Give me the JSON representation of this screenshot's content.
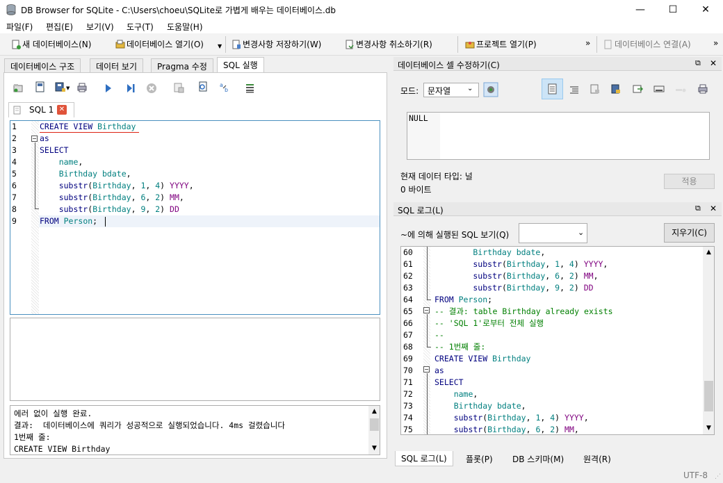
{
  "window": {
    "title": "DB Browser for SQLite - C:\\Users\\choeu\\SQLite로 가볍게 배우는 데이터베이스.db",
    "minimize": "—",
    "maximize": "☐",
    "close": "✕"
  },
  "menu": [
    "파일(F)",
    "편집(E)",
    "보기(V)",
    "도구(T)",
    "도움말(H)"
  ],
  "toolbar": {
    "new_db": "새 데이터베이스(N)",
    "open_db": "데이터베이스 열기(O)",
    "write_changes": "변경사항 저장하기(W)",
    "revert_changes": "변경사항 취소하기(R)",
    "open_project": "프로젝트 열기(P)",
    "more": "»",
    "attach_db": "데이터베이스 연결(A)",
    "more2": "»"
  },
  "main_tabs": [
    "데이터베이스 구조",
    "데이터 보기",
    "Pragma 수정",
    "SQL 실행"
  ],
  "sql_tab_label": "SQL 1",
  "editor": {
    "lines": [
      {
        "n": "1",
        "parts": [
          [
            "kw",
            "CREATE VIEW "
          ],
          [
            "id",
            "Birthday"
          ]
        ]
      },
      {
        "n": "2",
        "parts": [
          [
            "kw",
            "as"
          ]
        ]
      },
      {
        "n": "3",
        "parts": [
          [
            "kw",
            "SELECT"
          ]
        ]
      },
      {
        "n": "4",
        "parts": [
          [
            "id",
            "    name"
          ],
          [
            "tx",
            ","
          ]
        ]
      },
      {
        "n": "5",
        "parts": [
          [
            "id",
            "    Birthday bdate"
          ],
          [
            "tx",
            ","
          ]
        ]
      },
      {
        "n": "6",
        "parts": [
          [
            "kw",
            "    substr"
          ],
          [
            "tx",
            "("
          ],
          [
            "id",
            "Birthday"
          ],
          [
            "tx",
            ", "
          ],
          [
            "num",
            "1"
          ],
          [
            "tx",
            ", "
          ],
          [
            "num",
            "4"
          ],
          [
            "tx",
            ") "
          ],
          [
            "al",
            "YYYY"
          ],
          [
            "tx",
            ","
          ]
        ]
      },
      {
        "n": "7",
        "parts": [
          [
            "kw",
            "    substr"
          ],
          [
            "tx",
            "("
          ],
          [
            "id",
            "Birthday"
          ],
          [
            "tx",
            ", "
          ],
          [
            "num",
            "6"
          ],
          [
            "tx",
            ", "
          ],
          [
            "num",
            "2"
          ],
          [
            "tx",
            ") "
          ],
          [
            "al",
            "MM"
          ],
          [
            "tx",
            ","
          ]
        ]
      },
      {
        "n": "8",
        "parts": [
          [
            "kw",
            "    substr"
          ],
          [
            "tx",
            "("
          ],
          [
            "id",
            "Birthday"
          ],
          [
            "tx",
            ", "
          ],
          [
            "num",
            "9"
          ],
          [
            "tx",
            ", "
          ],
          [
            "num",
            "2"
          ],
          [
            "tx",
            ") "
          ],
          [
            "al",
            "DD"
          ]
        ]
      },
      {
        "n": "9",
        "parts": [
          [
            "kw",
            "FROM "
          ],
          [
            "id",
            "Person"
          ],
          [
            "tx",
            ";"
          ]
        ]
      }
    ]
  },
  "message": {
    "lines": [
      "에러 없이 실행 완료.",
      "결과:  데이터베이스에 쿼리가 성공적으로 실행되었습니다. 4ms 걸렸습니다",
      "1번째 줄:",
      "CREATE VIEW Birthday"
    ]
  },
  "cell_editor": {
    "title": "데이터베이스 셀 수정하기(C)",
    "mode_label": "모드:",
    "mode_value": "문자열",
    "value": "NULL",
    "type_label": "현재 데이터 타입: 널",
    "size_label": "0 바이트",
    "apply": "적용"
  },
  "sql_log": {
    "title": "SQL 로그(L)",
    "filter_label": "~에 의해 실행된 SQL 보기(Q)",
    "clear": "지우기(C)",
    "lines": [
      {
        "n": "60",
        "parts": [
          [
            "id",
            "        Birthday bdate"
          ],
          [
            "tx",
            ","
          ]
        ]
      },
      {
        "n": "61",
        "parts": [
          [
            "kw",
            "        substr"
          ],
          [
            "tx",
            "("
          ],
          [
            "id",
            "Birthday"
          ],
          [
            "tx",
            ", "
          ],
          [
            "num",
            "1"
          ],
          [
            "tx",
            ", "
          ],
          [
            "num",
            "4"
          ],
          [
            "tx",
            ") "
          ],
          [
            "al",
            "YYYY"
          ],
          [
            "tx",
            ","
          ]
        ]
      },
      {
        "n": "62",
        "parts": [
          [
            "kw",
            "        substr"
          ],
          [
            "tx",
            "("
          ],
          [
            "id",
            "Birthday"
          ],
          [
            "tx",
            ", "
          ],
          [
            "num",
            "6"
          ],
          [
            "tx",
            ", "
          ],
          [
            "num",
            "2"
          ],
          [
            "tx",
            ") "
          ],
          [
            "al",
            "MM"
          ],
          [
            "tx",
            ","
          ]
        ]
      },
      {
        "n": "63",
        "parts": [
          [
            "kw",
            "        substr"
          ],
          [
            "tx",
            "("
          ],
          [
            "id",
            "Birthday"
          ],
          [
            "tx",
            ", "
          ],
          [
            "num",
            "9"
          ],
          [
            "tx",
            ", "
          ],
          [
            "num",
            "2"
          ],
          [
            "tx",
            ") "
          ],
          [
            "al",
            "DD"
          ]
        ]
      },
      {
        "n": "64",
        "parts": [
          [
            "kw",
            "FROM "
          ],
          [
            "id",
            "Person"
          ],
          [
            "tx",
            ";"
          ]
        ]
      },
      {
        "n": "65",
        "parts": [
          [
            "cm",
            "-- 결과: table Birthday already exists"
          ]
        ]
      },
      {
        "n": "66",
        "parts": [
          [
            "cm",
            "-- 'SQL 1'로부터 전체 실행"
          ]
        ]
      },
      {
        "n": "67",
        "parts": [
          [
            "cm",
            "--"
          ]
        ]
      },
      {
        "n": "68",
        "parts": [
          [
            "cm",
            "-- 1번째 줄:"
          ]
        ]
      },
      {
        "n": "69",
        "parts": [
          [
            "kw",
            "CREATE VIEW "
          ],
          [
            "id",
            "Birthday"
          ]
        ]
      },
      {
        "n": "70",
        "parts": [
          [
            "kw",
            "as"
          ]
        ]
      },
      {
        "n": "71",
        "parts": [
          [
            "kw",
            "SELECT"
          ]
        ]
      },
      {
        "n": "72",
        "parts": [
          [
            "id",
            "    name"
          ],
          [
            "tx",
            ","
          ]
        ]
      },
      {
        "n": "73",
        "parts": [
          [
            "id",
            "    Birthday bdate"
          ],
          [
            "tx",
            ","
          ]
        ]
      },
      {
        "n": "74",
        "parts": [
          [
            "kw",
            "    substr"
          ],
          [
            "tx",
            "("
          ],
          [
            "id",
            "Birthday"
          ],
          [
            "tx",
            ", "
          ],
          [
            "num",
            "1"
          ],
          [
            "tx",
            ", "
          ],
          [
            "num",
            "4"
          ],
          [
            "tx",
            ") "
          ],
          [
            "al",
            "YYYY"
          ],
          [
            "tx",
            ","
          ]
        ]
      },
      {
        "n": "75",
        "parts": [
          [
            "kw",
            "    substr"
          ],
          [
            "tx",
            "("
          ],
          [
            "id",
            "Birthday"
          ],
          [
            "tx",
            ", "
          ],
          [
            "num",
            "6"
          ],
          [
            "tx",
            ", "
          ],
          [
            "num",
            "2"
          ],
          [
            "tx",
            ") "
          ],
          [
            "al",
            "MM"
          ],
          [
            "tx",
            ","
          ]
        ]
      }
    ]
  },
  "bottom_tabs": [
    "SQL 로그(L)",
    "플롯(P)",
    "DB 스키마(M)",
    "원격(R)"
  ],
  "status": {
    "encoding": "UTF-8"
  },
  "colors": {
    "keyword": "#00007f",
    "identifier": "#007f7f",
    "alias": "#7f007f",
    "comment": "#007f00",
    "selection": "#cce8ff"
  }
}
